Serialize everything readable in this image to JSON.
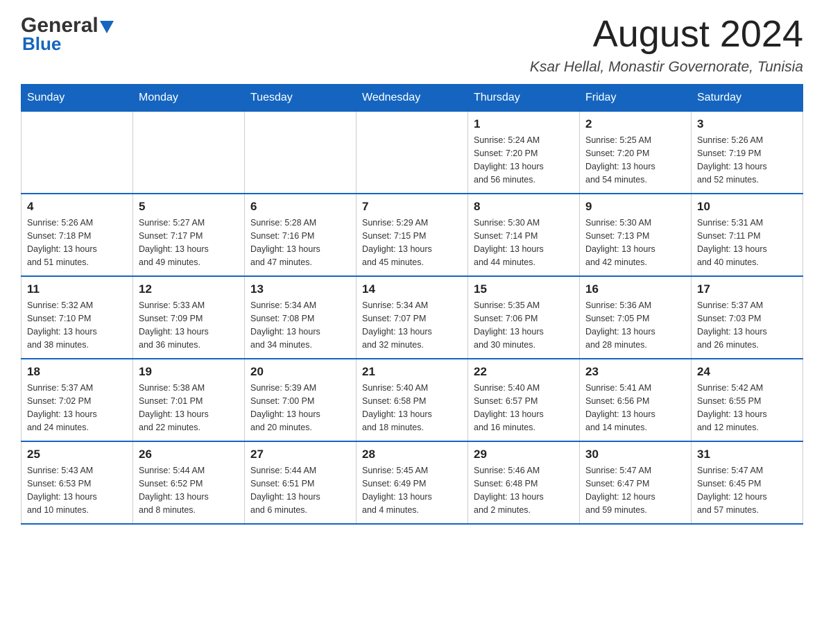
{
  "header": {
    "logo_general": "General",
    "logo_blue": "Blue",
    "month_title": "August 2024",
    "location": "Ksar Hellal, Monastir Governorate, Tunisia"
  },
  "calendar": {
    "days_of_week": [
      "Sunday",
      "Monday",
      "Tuesday",
      "Wednesday",
      "Thursday",
      "Friday",
      "Saturday"
    ],
    "weeks": [
      {
        "cells": [
          {
            "day": "",
            "info": ""
          },
          {
            "day": "",
            "info": ""
          },
          {
            "day": "",
            "info": ""
          },
          {
            "day": "",
            "info": ""
          },
          {
            "day": "1",
            "info": "Sunrise: 5:24 AM\nSunset: 7:20 PM\nDaylight: 13 hours\nand 56 minutes."
          },
          {
            "day": "2",
            "info": "Sunrise: 5:25 AM\nSunset: 7:20 PM\nDaylight: 13 hours\nand 54 minutes."
          },
          {
            "day": "3",
            "info": "Sunrise: 5:26 AM\nSunset: 7:19 PM\nDaylight: 13 hours\nand 52 minutes."
          }
        ]
      },
      {
        "cells": [
          {
            "day": "4",
            "info": "Sunrise: 5:26 AM\nSunset: 7:18 PM\nDaylight: 13 hours\nand 51 minutes."
          },
          {
            "day": "5",
            "info": "Sunrise: 5:27 AM\nSunset: 7:17 PM\nDaylight: 13 hours\nand 49 minutes."
          },
          {
            "day": "6",
            "info": "Sunrise: 5:28 AM\nSunset: 7:16 PM\nDaylight: 13 hours\nand 47 minutes."
          },
          {
            "day": "7",
            "info": "Sunrise: 5:29 AM\nSunset: 7:15 PM\nDaylight: 13 hours\nand 45 minutes."
          },
          {
            "day": "8",
            "info": "Sunrise: 5:30 AM\nSunset: 7:14 PM\nDaylight: 13 hours\nand 44 minutes."
          },
          {
            "day": "9",
            "info": "Sunrise: 5:30 AM\nSunset: 7:13 PM\nDaylight: 13 hours\nand 42 minutes."
          },
          {
            "day": "10",
            "info": "Sunrise: 5:31 AM\nSunset: 7:11 PM\nDaylight: 13 hours\nand 40 minutes."
          }
        ]
      },
      {
        "cells": [
          {
            "day": "11",
            "info": "Sunrise: 5:32 AM\nSunset: 7:10 PM\nDaylight: 13 hours\nand 38 minutes."
          },
          {
            "day": "12",
            "info": "Sunrise: 5:33 AM\nSunset: 7:09 PM\nDaylight: 13 hours\nand 36 minutes."
          },
          {
            "day": "13",
            "info": "Sunrise: 5:34 AM\nSunset: 7:08 PM\nDaylight: 13 hours\nand 34 minutes."
          },
          {
            "day": "14",
            "info": "Sunrise: 5:34 AM\nSunset: 7:07 PM\nDaylight: 13 hours\nand 32 minutes."
          },
          {
            "day": "15",
            "info": "Sunrise: 5:35 AM\nSunset: 7:06 PM\nDaylight: 13 hours\nand 30 minutes."
          },
          {
            "day": "16",
            "info": "Sunrise: 5:36 AM\nSunset: 7:05 PM\nDaylight: 13 hours\nand 28 minutes."
          },
          {
            "day": "17",
            "info": "Sunrise: 5:37 AM\nSunset: 7:03 PM\nDaylight: 13 hours\nand 26 minutes."
          }
        ]
      },
      {
        "cells": [
          {
            "day": "18",
            "info": "Sunrise: 5:37 AM\nSunset: 7:02 PM\nDaylight: 13 hours\nand 24 minutes."
          },
          {
            "day": "19",
            "info": "Sunrise: 5:38 AM\nSunset: 7:01 PM\nDaylight: 13 hours\nand 22 minutes."
          },
          {
            "day": "20",
            "info": "Sunrise: 5:39 AM\nSunset: 7:00 PM\nDaylight: 13 hours\nand 20 minutes."
          },
          {
            "day": "21",
            "info": "Sunrise: 5:40 AM\nSunset: 6:58 PM\nDaylight: 13 hours\nand 18 minutes."
          },
          {
            "day": "22",
            "info": "Sunrise: 5:40 AM\nSunset: 6:57 PM\nDaylight: 13 hours\nand 16 minutes."
          },
          {
            "day": "23",
            "info": "Sunrise: 5:41 AM\nSunset: 6:56 PM\nDaylight: 13 hours\nand 14 minutes."
          },
          {
            "day": "24",
            "info": "Sunrise: 5:42 AM\nSunset: 6:55 PM\nDaylight: 13 hours\nand 12 minutes."
          }
        ]
      },
      {
        "cells": [
          {
            "day": "25",
            "info": "Sunrise: 5:43 AM\nSunset: 6:53 PM\nDaylight: 13 hours\nand 10 minutes."
          },
          {
            "day": "26",
            "info": "Sunrise: 5:44 AM\nSunset: 6:52 PM\nDaylight: 13 hours\nand 8 minutes."
          },
          {
            "day": "27",
            "info": "Sunrise: 5:44 AM\nSunset: 6:51 PM\nDaylight: 13 hours\nand 6 minutes."
          },
          {
            "day": "28",
            "info": "Sunrise: 5:45 AM\nSunset: 6:49 PM\nDaylight: 13 hours\nand 4 minutes."
          },
          {
            "day": "29",
            "info": "Sunrise: 5:46 AM\nSunset: 6:48 PM\nDaylight: 13 hours\nand 2 minutes."
          },
          {
            "day": "30",
            "info": "Sunrise: 5:47 AM\nSunset: 6:47 PM\nDaylight: 12 hours\nand 59 minutes."
          },
          {
            "day": "31",
            "info": "Sunrise: 5:47 AM\nSunset: 6:45 PM\nDaylight: 12 hours\nand 57 minutes."
          }
        ]
      }
    ]
  }
}
